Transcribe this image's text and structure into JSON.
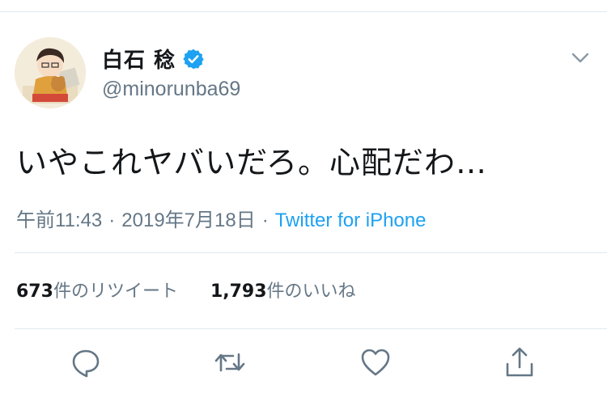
{
  "tweet": {
    "author_name": "白石 稔",
    "handle": "@minorunba69",
    "text": "いやこれヤバいだろ。心配だわ…",
    "time": "午前11:43",
    "date": "2019年7月18日",
    "separator": "·",
    "source": "Twitter for iPhone"
  },
  "stats": {
    "retweets_count": "673",
    "retweets_label": "件のリツイート",
    "likes_count": "1,793",
    "likes_label": "件のいいね"
  },
  "icons": {
    "verified": "verified-badge-icon",
    "menu": "chevron-down-icon",
    "reply": "reply-icon",
    "retweet": "retweet-icon",
    "like": "heart-icon",
    "share": "share-icon"
  },
  "colors": {
    "link": "#1da1f2",
    "secondary_text": "#657786",
    "primary_text": "#14171a",
    "divider": "#e1e8ed"
  }
}
